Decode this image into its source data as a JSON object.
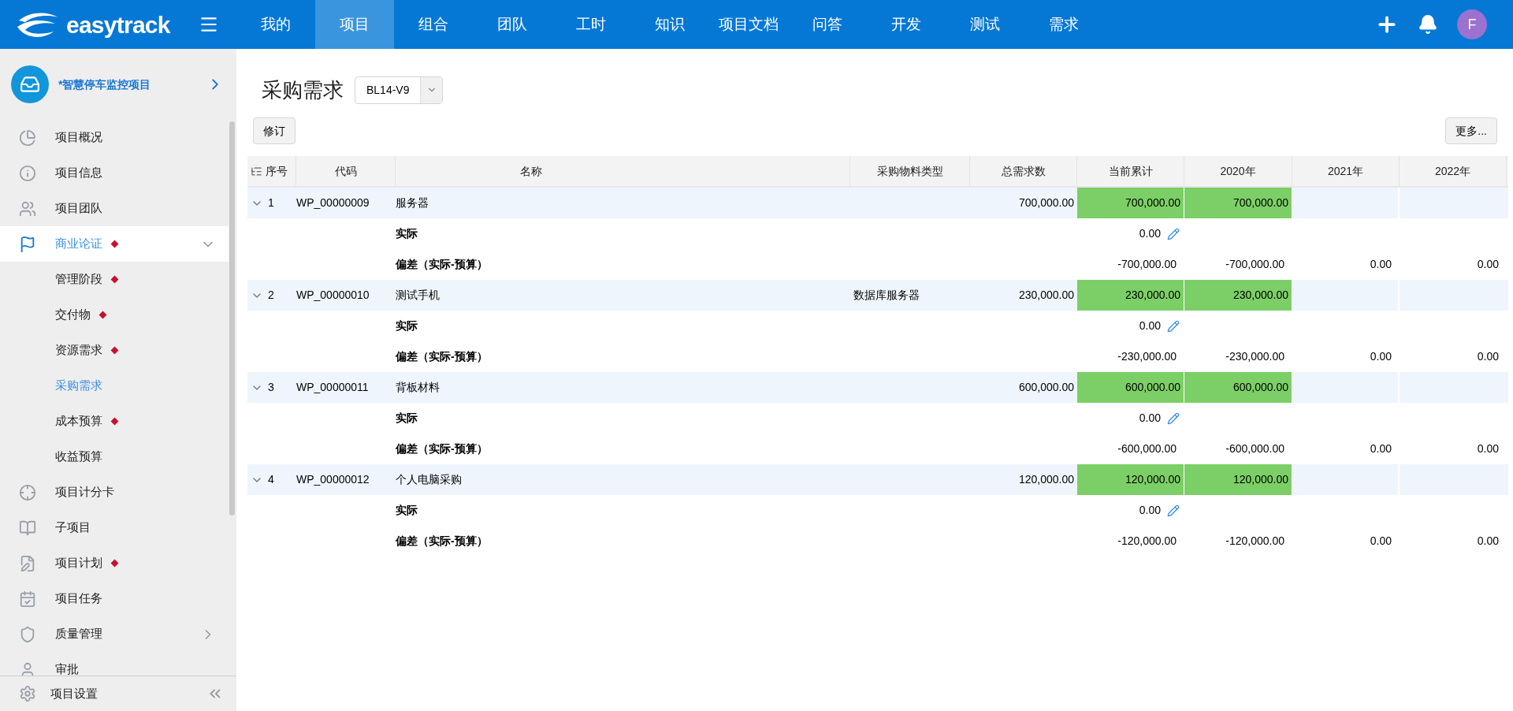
{
  "topbar": {
    "logo": "easytrack",
    "nav": [
      {
        "label": "我的",
        "selected": false
      },
      {
        "label": "项目",
        "selected": true
      },
      {
        "label": "组合",
        "selected": false
      },
      {
        "label": "团队",
        "selected": false
      },
      {
        "label": "工时",
        "selected": false
      },
      {
        "label": "知识",
        "selected": false
      },
      {
        "label": "项目文档",
        "selected": false
      },
      {
        "label": "问答",
        "selected": false
      },
      {
        "label": "开发",
        "selected": false
      },
      {
        "label": "测试",
        "selected": false
      },
      {
        "label": "需求",
        "selected": false
      }
    ],
    "avatar": "F"
  },
  "sidebar": {
    "project": "*智慧停车监控项目",
    "items": [
      {
        "label": "项目概况",
        "flagged": false,
        "selected": false
      },
      {
        "label": "项目信息",
        "flagged": false,
        "selected": false
      },
      {
        "label": "项目团队",
        "flagged": false,
        "selected": false
      },
      {
        "label": "商业论证",
        "flagged": true,
        "selected": true,
        "expanded": true,
        "children": [
          {
            "label": "管理阶段",
            "flagged": true,
            "selected": false
          },
          {
            "label": "交付物",
            "flagged": true,
            "selected": false
          },
          {
            "label": "资源需求",
            "flagged": true,
            "selected": false
          },
          {
            "label": "采购需求",
            "flagged": false,
            "selected": true
          },
          {
            "label": "成本预算",
            "flagged": true,
            "selected": false
          },
          {
            "label": "收益预算",
            "flagged": false,
            "selected": false
          }
        ]
      },
      {
        "label": "项目计分卡",
        "flagged": false,
        "selected": false
      },
      {
        "label": "子项目",
        "flagged": false,
        "selected": false
      },
      {
        "label": "项目计划",
        "flagged": true,
        "selected": false
      },
      {
        "label": "项目任务",
        "flagged": false,
        "selected": false
      },
      {
        "label": "质量管理",
        "flagged": false,
        "selected": false,
        "expanded": false
      },
      {
        "label": "审批",
        "flagged": false,
        "selected": false
      }
    ],
    "footer": "项目设置"
  },
  "page": {
    "title": "采购需求",
    "version": "BL14-V9",
    "revise_button": "修订",
    "more_button": "更多..."
  },
  "table": {
    "columns": [
      "序号",
      "代码",
      "名称",
      "采购物料类型",
      "总需求数",
      "当前累计",
      "2020年",
      "2021年",
      "2022年"
    ],
    "rows": [
      {
        "seq": "1",
        "code": "WP_00000009",
        "name": "服务器",
        "total": "700,000.00",
        "current": "700,000.00",
        "y2020": "700,000.00",
        "highlighted": true,
        "expanded": true,
        "actual_label": "实际",
        "actual": "0.00",
        "deviation_label": "偏差（实际-预算）",
        "deviation": [
          "-700,000.00",
          "-700,000.00",
          "0.00",
          "0.00"
        ]
      },
      {
        "seq": "2",
        "code": "WP_00000010",
        "name": "测试手机",
        "type": "数据库服务器",
        "total": "230,000.00",
        "current": "230,000.00",
        "y2020": "230,000.00",
        "highlighted": true,
        "expanded": true,
        "actual_label": "实际",
        "actual": "0.00",
        "deviation_label": "偏差（实际-预算）",
        "deviation": [
          "-230,000.00",
          "-230,000.00",
          "0.00",
          "0.00"
        ]
      },
      {
        "seq": "3",
        "code": "WP_00000011",
        "name": "背板材料",
        "total": "600,000.00",
        "current": "600,000.00",
        "y2020": "600,000.00",
        "highlighted": true,
        "expanded": true,
        "actual_label": "实际",
        "actual": "0.00",
        "deviation_label": "偏差（实际-预算）",
        "deviation": [
          "-600,000.00",
          "-600,000.00",
          "0.00",
          "0.00"
        ]
      },
      {
        "seq": "4",
        "code": "WP_00000012",
        "name": "个人电脑采购",
        "total": "120,000.00",
        "current": "120,000.00",
        "y2020": "120,000.00",
        "highlighted": true,
        "expanded": true,
        "actual_label": "实际",
        "actual": "0.00",
        "deviation_label": "偏差（实际-预算）",
        "deviation": [
          "-120,000.00",
          "-120,000.00",
          "0.00",
          "0.00"
        ]
      }
    ]
  }
}
